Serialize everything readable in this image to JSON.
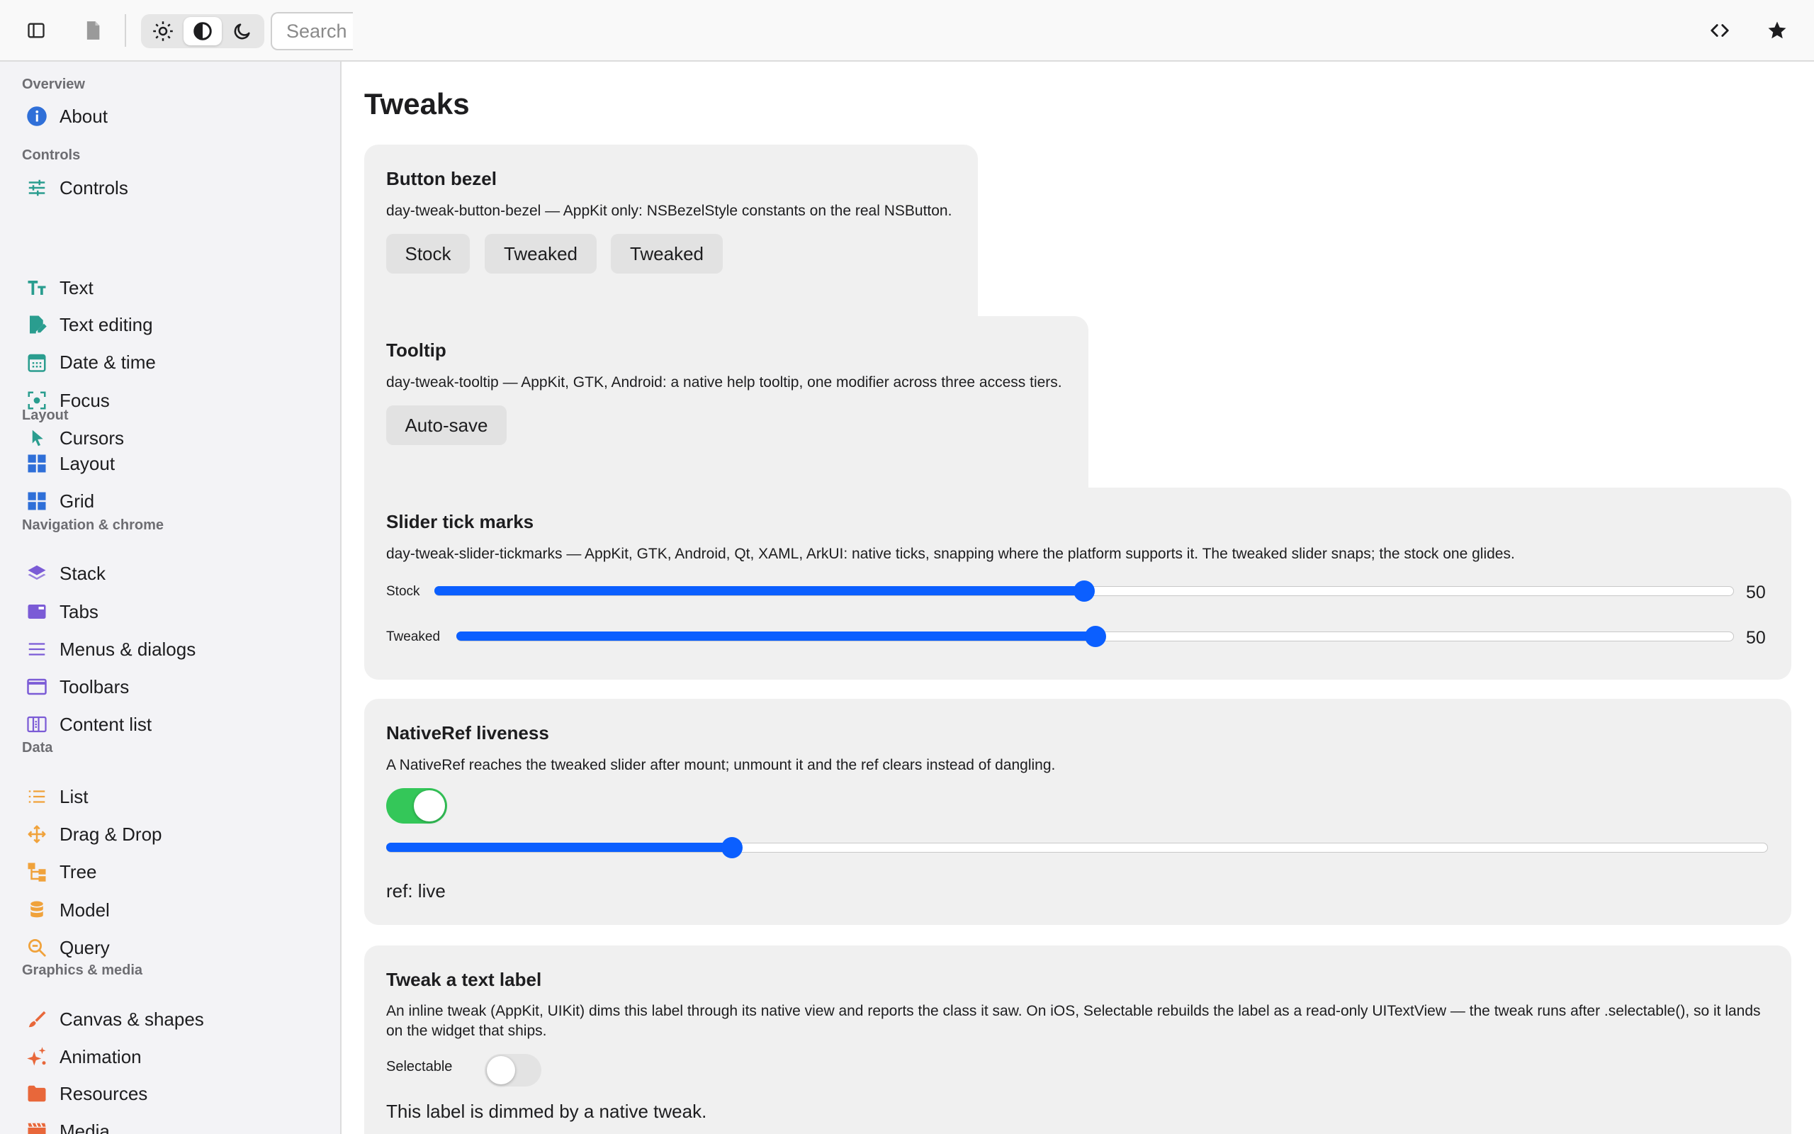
{
  "toolbar": {
    "search_placeholder": "Search",
    "colors": {
      "active_theme_bg": "#ffffff",
      "group_bg": "#e6e6e6"
    }
  },
  "sidebar": {
    "sections": [
      {
        "label": "Overview",
        "items": [
          {
            "label": "About",
            "icon": "info-icon",
            "color": "#2f6fd8"
          }
        ]
      },
      {
        "label": "Controls",
        "items": [
          {
            "label": "Controls",
            "icon": "sliders-icon",
            "color": "#2a9d8f"
          },
          {
            "label": "Text",
            "icon": "text-size-icon",
            "color": "#2a9d8f"
          },
          {
            "label": "Text editing",
            "icon": "edit-document-icon",
            "color": "#2a9d8f"
          },
          {
            "label": "Date & time",
            "icon": "calendar-icon",
            "color": "#2a9d8f"
          },
          {
            "label": "Focus",
            "icon": "focus-icon",
            "color": "#2a9d8f"
          },
          {
            "label": "Cursors",
            "icon": "cursor-icon",
            "color": "#2a9d8f"
          }
        ]
      },
      {
        "label": "Layout",
        "items": [
          {
            "label": "Layout",
            "icon": "layout-grid-icon",
            "color": "#2f6fd8"
          },
          {
            "label": "Grid",
            "icon": "grid-icon",
            "color": "#2f6fd8"
          }
        ]
      },
      {
        "label": "Navigation & chrome",
        "items": [
          {
            "label": "Stack",
            "icon": "layers-icon",
            "color": "#7b5bd6"
          },
          {
            "label": "Tabs",
            "icon": "tabs-icon",
            "color": "#7b5bd6"
          },
          {
            "label": "Menus & dialogs",
            "icon": "menu-icon",
            "color": "#7b5bd6"
          },
          {
            "label": "Toolbars",
            "icon": "window-icon",
            "color": "#7b5bd6"
          },
          {
            "label": "Content list",
            "icon": "columns-icon",
            "color": "#7b5bd6"
          }
        ]
      },
      {
        "label": "Data",
        "items": [
          {
            "label": "List",
            "icon": "list-icon",
            "color": "#f0a23b"
          },
          {
            "label": "Drag & Drop",
            "icon": "move-icon",
            "color": "#f0a23b"
          },
          {
            "label": "Tree",
            "icon": "tree-icon",
            "color": "#f0a23b"
          },
          {
            "label": "Model",
            "icon": "database-icon",
            "color": "#f0a23b"
          },
          {
            "label": "Query",
            "icon": "search-zoom-icon",
            "color": "#f0a23b"
          }
        ]
      },
      {
        "label": "Graphics & media",
        "items": [
          {
            "label": "Canvas & shapes",
            "icon": "brush-icon",
            "color": "#e8673a"
          },
          {
            "label": "Animation",
            "icon": "sparkle-icon",
            "color": "#e8673a"
          },
          {
            "label": "Resources",
            "icon": "folder-icon",
            "color": "#e8673a"
          },
          {
            "label": "Media",
            "icon": "film-icon",
            "color": "#e8673a"
          }
        ]
      }
    ]
  },
  "main": {
    "title": "Tweaks",
    "bezel": {
      "title": "Button bezel",
      "desc": "day-tweak-button-bezel — AppKit only: NSBezelStyle constants on the real NSButton.",
      "buttons": [
        "Stock",
        "Tweaked",
        "Tweaked"
      ]
    },
    "tooltip": {
      "title": "Tooltip",
      "desc": "day-tweak-tooltip — AppKit, GTK, Android: a native help tooltip, one modifier across three access tiers.",
      "button": "Auto-save"
    },
    "ticks": {
      "title": "Slider tick marks",
      "desc": "day-tweak-slider-tickmarks — AppKit, GTK, Android, Qt, XAML, ArkUI: native ticks, snapping where the platform supports it. The tweaked slider snaps; the stock one glides.",
      "stock_label": "Stock",
      "stock_value": "50",
      "stock_fraction": 0.5,
      "tweaked_label": "Tweaked",
      "tweaked_value": "50",
      "tweaked_fraction": 0.5
    },
    "nativeref": {
      "title": "NativeRef liveness",
      "desc": "A NativeRef reaches the tweaked slider after mount; unmount it and the ref clears instead of dangling.",
      "switch_on": true,
      "slider_fraction": 0.25,
      "ref_text": "ref: live"
    },
    "textlabel": {
      "title": "Tweak a text label",
      "desc": "An inline tweak (AppKit, UIKit) dims this label through its native view and reports the class it saw. On iOS, Selectable rebuilds the label as a read-only UITextView — the tweak runs after .selectable(), so it lands on the widget that ships.",
      "selectable_label": "Selectable",
      "selectable_on": false,
      "label_text": "This label is dimmed by a native tweak."
    }
  }
}
